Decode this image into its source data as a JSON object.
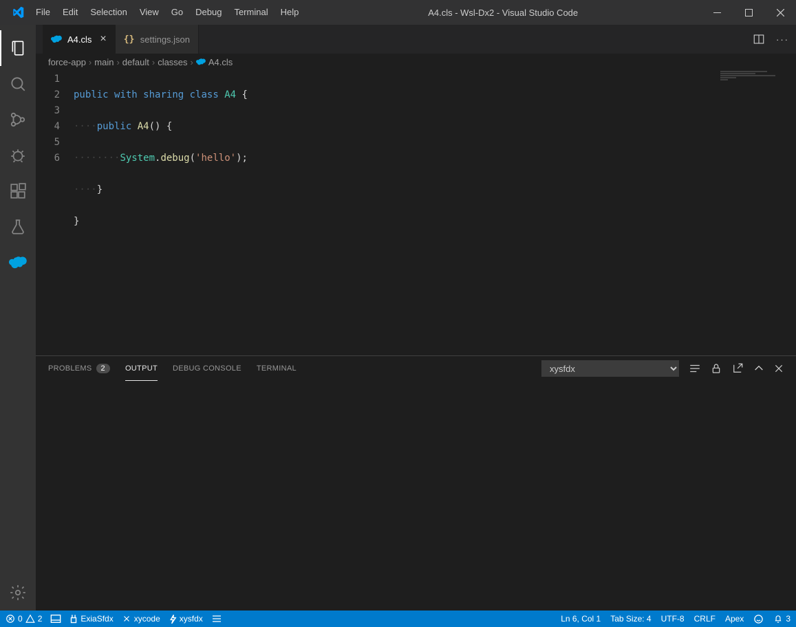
{
  "window": {
    "title": "A4.cls - Wsl-Dx2 - Visual Studio Code"
  },
  "menu": {
    "file": "File",
    "edit": "Edit",
    "selection": "Selection",
    "view": "View",
    "go": "Go",
    "debug": "Debug",
    "terminal": "Terminal",
    "help": "Help"
  },
  "tabs": {
    "active": {
      "label": "A4.cls"
    },
    "second": {
      "label": "settings.json"
    }
  },
  "breadcrumbs": {
    "seg1": "force-app",
    "seg2": "main",
    "seg3": "default",
    "seg4": "classes",
    "seg5": "A4.cls"
  },
  "gutter": {
    "l1": "1",
    "l2": "2",
    "l3": "3",
    "l4": "4",
    "l5": "5",
    "l6": "6"
  },
  "code": {
    "l1": {
      "kw1": "public",
      "ws1": " ",
      "kw2": "with",
      "ws2": " ",
      "kw3": "sharing",
      "ws3": " ",
      "kw4": "class",
      "ws4": " ",
      "cls": "A4",
      "rest": " {"
    },
    "l2": {
      "dots": "····",
      "kw": "public",
      "ws": " ",
      "fn": "A4",
      "rest": "() {"
    },
    "l3": {
      "dots": "····",
      "dots2": "····",
      "cls": "System",
      "dot": ".",
      "fn": "debug",
      "p1": "(",
      "str": "'hello'",
      "p2": ");"
    },
    "l4": {
      "dots": "····",
      "rest": "}"
    },
    "l5": {
      "rest": "}"
    }
  },
  "panel": {
    "problems": "Problems",
    "problems_badge": "2",
    "output": "Output",
    "debug_console": "Debug Console",
    "terminal": "Terminal",
    "channel": "xysfdx"
  },
  "status": {
    "errors": "0",
    "warnings": "2",
    "ext1": "ExiaSfdx",
    "ext2": "xycode",
    "ext3": "xysfdx",
    "lncol": "Ln 6, Col 1",
    "tabsize": "Tab Size: 4",
    "encoding": "UTF-8",
    "eol": "CRLF",
    "lang": "Apex",
    "notif": "3"
  }
}
